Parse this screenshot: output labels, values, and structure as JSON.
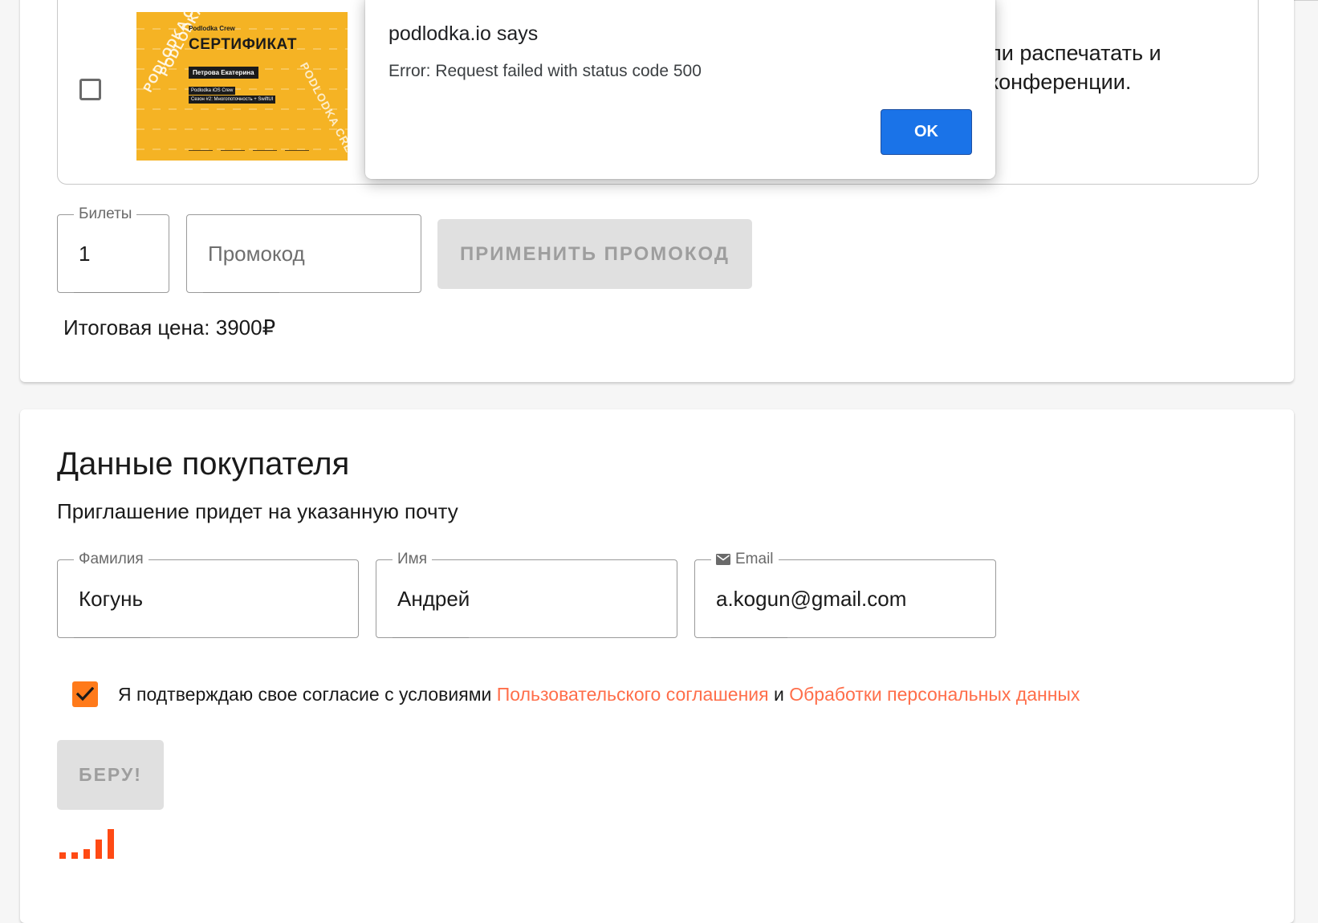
{
  "merch": {
    "description_line1": "ли распечатать и",
    "description_line2": "конференции.",
    "certificate": {
      "brand": "Podlodka Crew",
      "title": "СЕРТИФИКАТ",
      "name": "Петрова Екатерина",
      "course_line1": "Podlodka iOS Crew",
      "course_line2": "Сезон #2: Многопоточность + SwiftUI",
      "diagonal_text": "PODLODKA CREW"
    }
  },
  "tickets": {
    "label": "Билеты",
    "value": "1"
  },
  "promo": {
    "placeholder": "Промокод",
    "apply_label": "ПРИМЕНИТЬ ПРОМОКОД"
  },
  "total": {
    "text": "Итоговая цена: 3900₽"
  },
  "buyer": {
    "heading": "Данные покупателя",
    "subtitle": "Приглашение придет на указанную почту",
    "last_name": {
      "label": "Фамилия",
      "value": "Когунь"
    },
    "first_name": {
      "label": "Имя",
      "value": "Андрей"
    },
    "email": {
      "label": "Email",
      "value": "a.kogun@gmail.com",
      "icon": "mail-icon"
    },
    "consent": {
      "text": "Я подтверждаю свое согласие с условиями",
      "link1": "Пользовательского соглашения",
      "conj": "и",
      "link2": "Обработки персональных данных",
      "checked": true
    },
    "submit_label": "БЕРУ!"
  },
  "dialog": {
    "title": "podlodka.io says",
    "message": "Error: Request failed with status code 500",
    "ok_label": "OK"
  },
  "colors": {
    "accent_orange": "#ff7a1a",
    "link_orange": "#ff6e4a",
    "dialog_button_blue": "#1a73e8",
    "certificate_yellow": "#f5b324"
  }
}
